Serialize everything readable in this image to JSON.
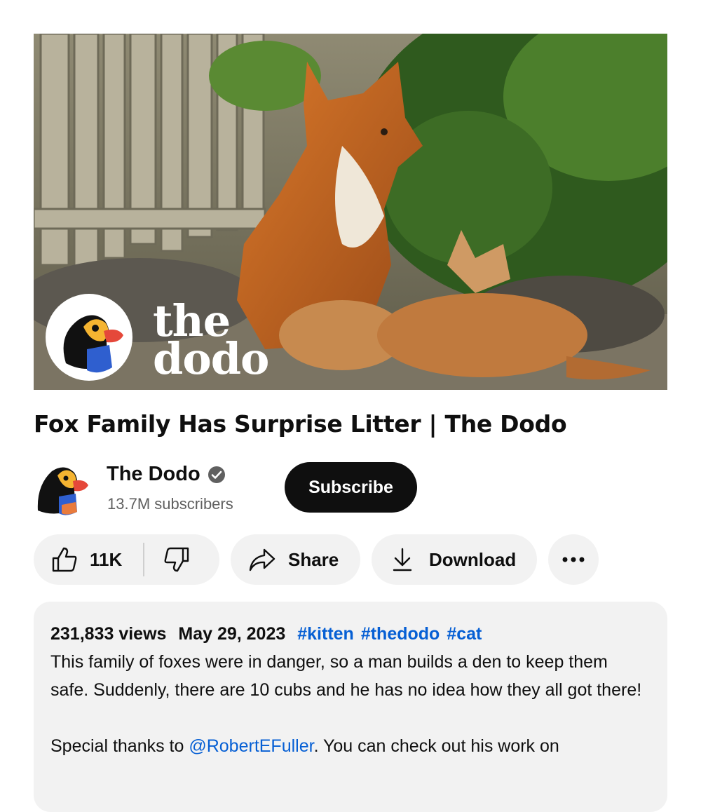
{
  "video": {
    "thumbnail_brand": "the dodo",
    "thumbnail_brand_line1": "the",
    "thumbnail_brand_line2": "dodo",
    "title": "Fox Family Has Surprise Litter | The Dodo"
  },
  "channel": {
    "name": "The Dodo",
    "verified": true,
    "subscribers": "13.7M subscribers",
    "subscribe_label": "Subscribe"
  },
  "actions": {
    "like_count": "11K",
    "share_label": "Share",
    "download_label": "Download",
    "more_icon": "more-horizontal-icon"
  },
  "description": {
    "views": "231,833 views",
    "date": "May 29, 2023",
    "hashtags": [
      "#kitten",
      "#thedodo",
      "#cat"
    ],
    "body": "This family of foxes were in danger, so a man builds a den to keep them safe. Suddenly, there are 10 cubs and he has no idea how they all got there!",
    "thanks_prefix": "Special thanks to ",
    "thanks_mention": "@RobertEFuller",
    "thanks_suffix": ". You can check out his work on"
  },
  "colors": {
    "link": "#065fd4",
    "subscribe_bg": "#0f0f0f",
    "pill_bg": "#f2f2f2",
    "secondary_text": "#606060"
  }
}
